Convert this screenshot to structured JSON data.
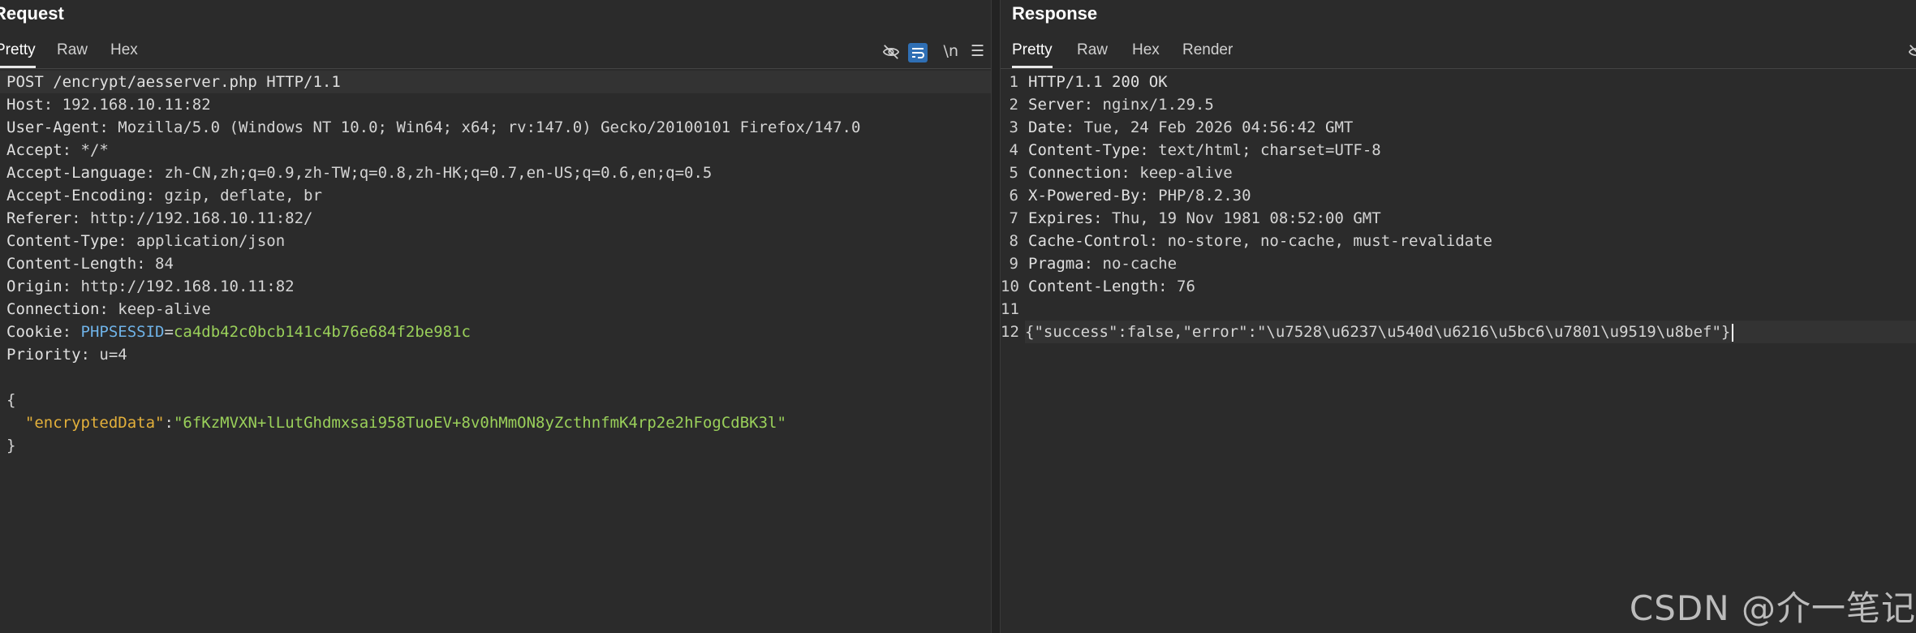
{
  "request": {
    "title": "Request",
    "tabs": [
      "Pretty",
      "Raw",
      "Hex"
    ],
    "toolbar": {
      "newline_label": "\\n"
    },
    "lines": [
      {
        "segments": [
          {
            "t": "POST /encrypt/aesserver.php HTTP/1.1",
            "c": "k"
          }
        ]
      },
      {
        "segments": [
          {
            "t": "Host",
            "c": "k"
          },
          {
            "t": ": 192.168.10.11:82",
            "c": "v"
          }
        ]
      },
      {
        "segments": [
          {
            "t": "User-Agent",
            "c": "k"
          },
          {
            "t": ": Mozilla/5.0 (Windows NT 10.0; Win64; x64; rv:147.0) Gecko/20100101 Firefox/147.0",
            "c": "v"
          }
        ]
      },
      {
        "segments": [
          {
            "t": "Accept",
            "c": "k"
          },
          {
            "t": ": */*",
            "c": "v"
          }
        ]
      },
      {
        "segments": [
          {
            "t": "Accept-Language",
            "c": "k"
          },
          {
            "t": ": zh-CN,zh;q=0.9,zh-TW;q=0.8,zh-HK;q=0.7,en-US;q=0.6,en;q=0.5",
            "c": "v"
          }
        ]
      },
      {
        "segments": [
          {
            "t": "Accept-Encoding",
            "c": "k"
          },
          {
            "t": ": gzip, deflate, br",
            "c": "v"
          }
        ]
      },
      {
        "segments": [
          {
            "t": "Referer",
            "c": "k"
          },
          {
            "t": ": http://192.168.10.11:82/",
            "c": "v"
          }
        ]
      },
      {
        "segments": [
          {
            "t": "Content-Type",
            "c": "k"
          },
          {
            "t": ": application/json",
            "c": "v"
          }
        ]
      },
      {
        "segments": [
          {
            "t": "Content-Length",
            "c": "k"
          },
          {
            "t": ": 84",
            "c": "v"
          }
        ]
      },
      {
        "segments": [
          {
            "t": "Origin",
            "c": "k"
          },
          {
            "t": ": http://192.168.10.11:82",
            "c": "v"
          }
        ]
      },
      {
        "segments": [
          {
            "t": "Connection",
            "c": "k"
          },
          {
            "t": ": keep-alive",
            "c": "v"
          }
        ]
      },
      {
        "segments": [
          {
            "t": "Cookie",
            "c": "k"
          },
          {
            "t": ": ",
            "c": "v"
          },
          {
            "t": "PHPSESSID",
            "c": "c-name"
          },
          {
            "t": "=",
            "c": "v"
          },
          {
            "t": "ca4db42c0bcb141c4b76e684f2be981c",
            "c": "c-val"
          }
        ]
      },
      {
        "segments": [
          {
            "t": "Priority",
            "c": "k"
          },
          {
            "t": ": u=4",
            "c": "v"
          }
        ]
      },
      {
        "segments": []
      },
      {
        "segments": [
          {
            "t": "{",
            "c": "punct"
          }
        ]
      },
      {
        "segments": [
          {
            "t": "  ",
            "c": "punct"
          },
          {
            "t": "\"encryptedData\"",
            "c": "jkey"
          },
          {
            "t": ":",
            "c": "punct"
          },
          {
            "t": "\"6fKzMVXN+lLutGhdmxsai958TuoEV+8v0hMmON8yZcthnfmK4rp2e2hFogCdBK3l\"",
            "c": "jstr"
          }
        ]
      },
      {
        "segments": [
          {
            "t": "}",
            "c": "punct"
          }
        ]
      }
    ]
  },
  "response": {
    "title": "Response",
    "tabs": [
      "Pretty",
      "Raw",
      "Hex",
      "Render"
    ],
    "lines": [
      {
        "n": "1",
        "segments": [
          {
            "t": "HTTP/1.1 200 OK",
            "c": "k"
          }
        ]
      },
      {
        "n": "2",
        "segments": [
          {
            "t": "Server",
            "c": "k"
          },
          {
            "t": ": nginx/1.29.5",
            "c": "v"
          }
        ]
      },
      {
        "n": "3",
        "segments": [
          {
            "t": "Date",
            "c": "k"
          },
          {
            "t": ": Tue, 24 Feb 2026 04:56:42 GMT",
            "c": "v"
          }
        ]
      },
      {
        "n": "4",
        "segments": [
          {
            "t": "Content-Type",
            "c": "k"
          },
          {
            "t": ": text/html; charset=UTF-8",
            "c": "v"
          }
        ]
      },
      {
        "n": "5",
        "segments": [
          {
            "t": "Connection",
            "c": "k"
          },
          {
            "t": ": keep-alive",
            "c": "v"
          }
        ]
      },
      {
        "n": "6",
        "segments": [
          {
            "t": "X-Powered-By",
            "c": "k"
          },
          {
            "t": ": PHP/8.2.30",
            "c": "v"
          }
        ]
      },
      {
        "n": "7",
        "segments": [
          {
            "t": "Expires",
            "c": "k"
          },
          {
            "t": ": Thu, 19 Nov 1981 08:52:00 GMT",
            "c": "v"
          }
        ]
      },
      {
        "n": "8",
        "segments": [
          {
            "t": "Cache-Control",
            "c": "k"
          },
          {
            "t": ": no-store, no-cache, must-revalidate",
            "c": "v"
          }
        ]
      },
      {
        "n": "9",
        "segments": [
          {
            "t": "Pragma",
            "c": "k"
          },
          {
            "t": ": no-cache",
            "c": "v"
          }
        ]
      },
      {
        "n": "10",
        "segments": [
          {
            "t": "Content-Length",
            "c": "k"
          },
          {
            "t": ": 76",
            "c": "v"
          }
        ]
      },
      {
        "n": "11",
        "segments": []
      },
      {
        "n": "12",
        "segments": [
          {
            "t": "{\"success\":false,\"error\":\"\\u7528\\u6237\\u540d\\u6216\\u5bc6\\u7801\\u9519\\u8bef\"}",
            "c": "v"
          }
        ]
      }
    ]
  },
  "watermark": "CSDN @介一笔记",
  "colors": {
    "background": "#2b2b2b",
    "cookie_name": "#6fb3e8",
    "cookie_value": "#9ad05a",
    "json_key": "#e3b03b",
    "json_string": "#9ad05a",
    "wrap_icon_bg": "#2f6fb4"
  }
}
